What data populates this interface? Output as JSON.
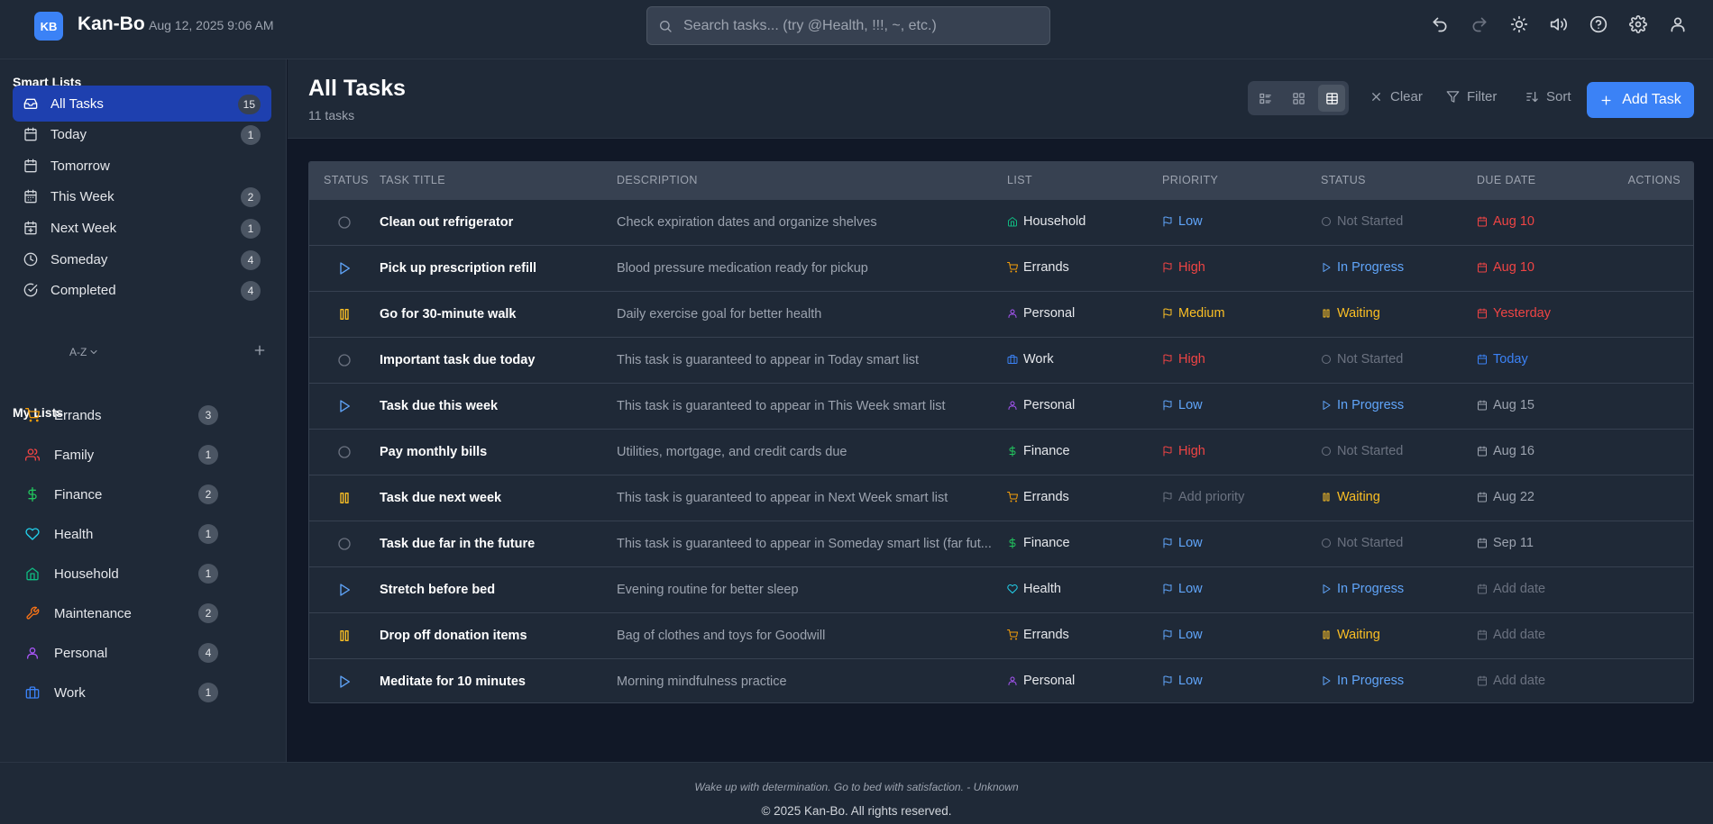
{
  "header": {
    "logo_text": "KB",
    "app_name": "Kan-Bo",
    "datetime": "Aug 12, 2025 9:06 AM",
    "search_placeholder": "Search tasks... (try @Health, !!!, ~, etc.)",
    "icons": [
      "undo-icon",
      "redo-icon",
      "sun-icon",
      "volume-icon",
      "help-icon",
      "settings-icon",
      "user-icon"
    ]
  },
  "sidebar": {
    "smart_heading": "Smart Lists",
    "smart_lists": [
      {
        "label": "All Tasks",
        "count": "15",
        "icon": "inbox-icon",
        "active": true
      },
      {
        "label": "Today",
        "count": "1",
        "icon": "calendar-icon"
      },
      {
        "label": "Tomorrow",
        "count": "",
        "icon": "calendar-icon"
      },
      {
        "label": "This Week",
        "count": "2",
        "icon": "calendar-week-icon"
      },
      {
        "label": "Next Week",
        "count": "1",
        "icon": "calendar-plus-icon"
      },
      {
        "label": "Someday",
        "count": "4",
        "icon": "clock-icon"
      },
      {
        "label": "Completed",
        "count": "4",
        "icon": "check-circle-icon"
      }
    ],
    "my_lists_heading": "My Lists",
    "sort_label": "A-Z",
    "lists": [
      {
        "label": "Errands",
        "count": "3",
        "icon": "cart-icon",
        "color": "#f59e0b"
      },
      {
        "label": "Family",
        "count": "1",
        "icon": "users-icon",
        "color": "#ef4444"
      },
      {
        "label": "Finance",
        "count": "2",
        "icon": "dollar-icon",
        "color": "#22c55e"
      },
      {
        "label": "Health",
        "count": "1",
        "icon": "heart-icon",
        "color": "#22d3ee"
      },
      {
        "label": "Household",
        "count": "1",
        "icon": "home-icon",
        "color": "#10b981"
      },
      {
        "label": "Maintenance",
        "count": "2",
        "icon": "wrench-icon",
        "color": "#f97316"
      },
      {
        "label": "Personal",
        "count": "4",
        "icon": "person-icon",
        "color": "#a855f7"
      },
      {
        "label": "Work",
        "count": "1",
        "icon": "briefcase-icon",
        "color": "#3b82f6"
      }
    ]
  },
  "main": {
    "title": "All Tasks",
    "subtitle": "11 tasks",
    "toolbar": {
      "clear": "Clear",
      "filter": "Filter",
      "sort": "Sort",
      "add": "Add Task"
    },
    "columns": [
      "STATUS",
      "TASK TITLE",
      "DESCRIPTION",
      "LIST",
      "PRIORITY",
      "STATUS",
      "DUE DATE",
      "ACTIONS"
    ],
    "tasks": [
      {
        "state": "not-started",
        "title": "Clean out refrigerator",
        "description": "Check expiration dates and organize shelves",
        "list": "Household",
        "priority": "Low",
        "status": "Not Started",
        "due": "Aug 10",
        "due_kind": "overdue"
      },
      {
        "state": "in-progress",
        "title": "Pick up prescription refill",
        "description": "Blood pressure medication ready for pickup",
        "list": "Errands",
        "priority": "High",
        "status": "In Progress",
        "due": "Aug 10",
        "due_kind": "overdue"
      },
      {
        "state": "waiting",
        "title": "Go for 30-minute walk",
        "description": "Daily exercise goal for better health",
        "list": "Personal",
        "priority": "Medium",
        "status": "Waiting",
        "due": "Yesterday",
        "due_kind": "overdue"
      },
      {
        "state": "not-started",
        "title": "Important task due today",
        "description": "This task is guaranteed to appear in Today smart list",
        "list": "Work",
        "priority": "High",
        "status": "Not Started",
        "due": "Today",
        "due_kind": "today"
      },
      {
        "state": "in-progress",
        "title": "Task due this week",
        "description": "This task is guaranteed to appear in This Week smart list",
        "list": "Personal",
        "priority": "Low",
        "status": "In Progress",
        "due": "Aug 15",
        "due_kind": "future"
      },
      {
        "state": "not-started",
        "title": "Pay monthly bills",
        "description": "Utilities, mortgage, and credit cards due",
        "list": "Finance",
        "priority": "High",
        "status": "Not Started",
        "due": "Aug 16",
        "due_kind": "future"
      },
      {
        "state": "waiting",
        "title": "Task due next week",
        "description": "This task is guaranteed to appear in Next Week smart list",
        "list": "Errands",
        "priority": "Add priority",
        "status": "Waiting",
        "due": "Aug 22",
        "due_kind": "future"
      },
      {
        "state": "not-started",
        "title": "Task due far in the future",
        "description": "This task is guaranteed to appear in Someday smart list (far fut...",
        "list": "Finance",
        "priority": "Low",
        "status": "Not Started",
        "due": "Sep 11",
        "due_kind": "future"
      },
      {
        "state": "in-progress",
        "title": "Stretch before bed",
        "description": "Evening routine for better sleep",
        "list": "Health",
        "priority": "Low",
        "status": "In Progress",
        "due": "Add date",
        "due_kind": "none"
      },
      {
        "state": "waiting",
        "title": "Drop off donation items",
        "description": "Bag of clothes and toys for Goodwill",
        "list": "Errands",
        "priority": "Low",
        "status": "Waiting",
        "due": "Add date",
        "due_kind": "none"
      },
      {
        "state": "in-progress",
        "title": "Meditate for 10 minutes",
        "description": "Morning mindfulness practice",
        "list": "Personal",
        "priority": "Low",
        "status": "In Progress",
        "due": "Add date",
        "due_kind": "none"
      }
    ]
  },
  "colors": {
    "accent": "#3b82f6",
    "low": "#60a5fa",
    "high": "#ef4444",
    "medium": "#fbbf24",
    "none": "#6b7280",
    "waiting": "#fbbf24",
    "in_progress": "#60a5fa",
    "not_started": "#6b7280",
    "overdue": "#ef4444",
    "today": "#3b82f6",
    "future": "#9ca3af"
  },
  "footer": {
    "quote": "Wake up with determination. Go to bed with satisfaction. - Unknown",
    "copyright": "© 2025 Kan-Bo. All rights reserved."
  }
}
